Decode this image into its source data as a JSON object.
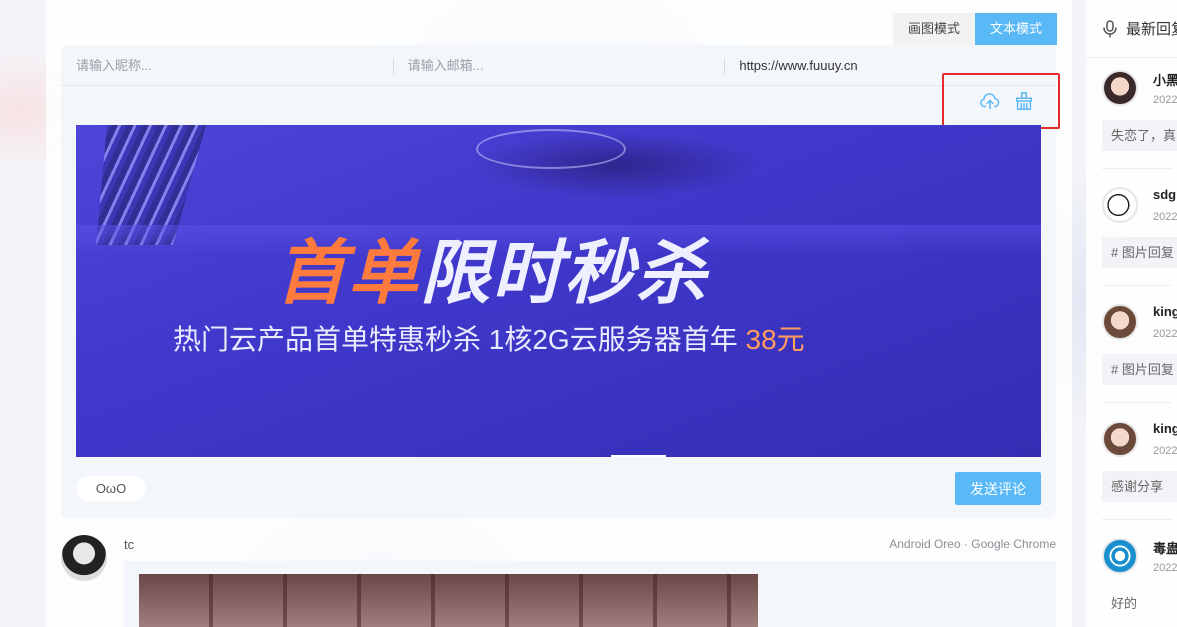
{
  "mode_toggle": {
    "image_mode": "画图模式",
    "text_mode": "文本模式",
    "active": "text_mode"
  },
  "comment_form": {
    "nickname": {
      "placeholder": "请输入昵称...",
      "value": ""
    },
    "email": {
      "placeholder": "请输入邮箱...",
      "value": ""
    },
    "website": {
      "placeholder": "",
      "value": "https://www.fuuuy.cn"
    },
    "icons": [
      "upload-cloud-icon",
      "clear-basket-icon"
    ],
    "banner": {
      "title_part1": "首单",
      "title_part2": "限时秒杀",
      "subtitle": "热门云产品首单特惠秒杀  1核2G云服务器首年 ",
      "price": "38元"
    },
    "owo_label": "OωO",
    "send_label": "发送评论"
  },
  "comment": {
    "author": "tc",
    "meta": "Android Oreo · Google Chrome"
  },
  "sidebar": {
    "title": "最新回复",
    "items": [
      {
        "name": "小黑",
        "date": "2022",
        "text": "失恋了，真"
      },
      {
        "name": "sdg",
        "date": "2022",
        "text": "# 图片回复"
      },
      {
        "name": "king",
        "date": "2022",
        "text": "# 图片回复"
      },
      {
        "name": "king",
        "date": "2022",
        "text": "感谢分享"
      },
      {
        "name": "毒蛊",
        "date": "2022",
        "text": "好的"
      }
    ]
  },
  "colors": {
    "accent": "#59b9f7",
    "highlight": "#e52b2b",
    "banner_orange": "#ff7a3d"
  }
}
